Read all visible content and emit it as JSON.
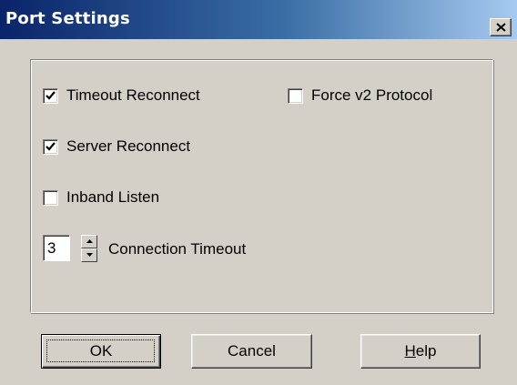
{
  "window": {
    "title": "Port Settings",
    "close_icon": "close-icon"
  },
  "options": {
    "timeout_reconnect": {
      "label": "Timeout Reconnect",
      "checked": true
    },
    "force_v2_protocol": {
      "label": "Force v2 Protocol",
      "checked": false
    },
    "server_reconnect": {
      "label": "Server Reconnect",
      "checked": true
    },
    "inband_listen": {
      "label": "Inband Listen",
      "checked": false
    }
  },
  "connection_timeout": {
    "value": "3",
    "label": "Connection Timeout"
  },
  "buttons": {
    "ok_label": "OK",
    "cancel_label": "Cancel",
    "help_label_mnemonic": "H",
    "help_label_rest": "elp"
  }
}
